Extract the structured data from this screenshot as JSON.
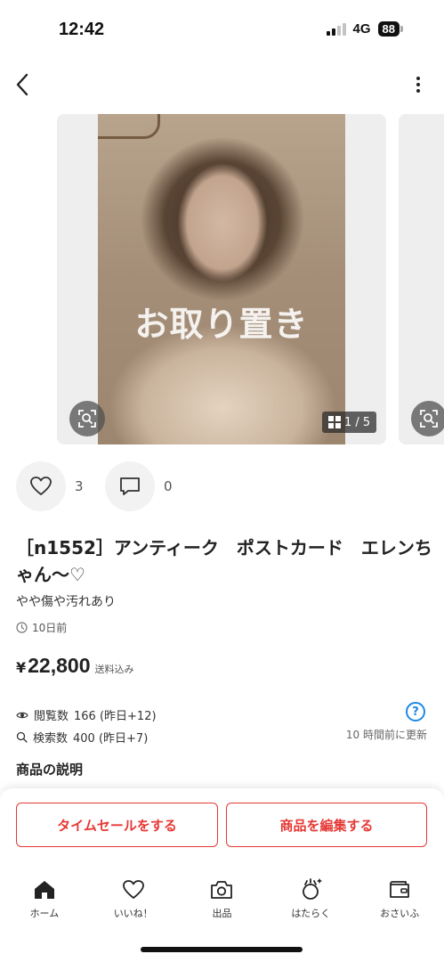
{
  "status_bar": {
    "time": "12:42",
    "network": "4G",
    "battery": "88"
  },
  "gallery": {
    "watermark": "お取り置き",
    "counter": "1 / 5"
  },
  "actions": {
    "like_count": "3",
    "comment_count": "0"
  },
  "item": {
    "title": "［n1552］アンティーク　ポストカード　エレンちゃん〜♡",
    "condition": "やや傷や汚れあり",
    "posted": "10日前",
    "currency": "¥",
    "price": "22,800",
    "shipping": "送料込み"
  },
  "stats": {
    "views_label": "閲覧数",
    "views_value": "166 (昨日+12)",
    "search_label": "検索数",
    "search_value": "400 (昨日+7)",
    "updated": "10 時間前に更新",
    "help": "?"
  },
  "section": {
    "description_heading": "商品の説明"
  },
  "footer": {
    "time_sale_label": "タイムセールをする",
    "edit_label": "商品を編集する"
  },
  "tabbar": {
    "items": [
      {
        "label": "ホーム",
        "icon": "home-icon"
      },
      {
        "label": "いいね！",
        "icon": "heart-icon"
      },
      {
        "label": "出品",
        "icon": "camera-icon"
      },
      {
        "label": "はたらく",
        "icon": "work-icon"
      },
      {
        "label": "おさいふ",
        "icon": "wallet-icon"
      }
    ]
  },
  "colors": {
    "accent": "#e53935",
    "link": "#1e88e5"
  }
}
